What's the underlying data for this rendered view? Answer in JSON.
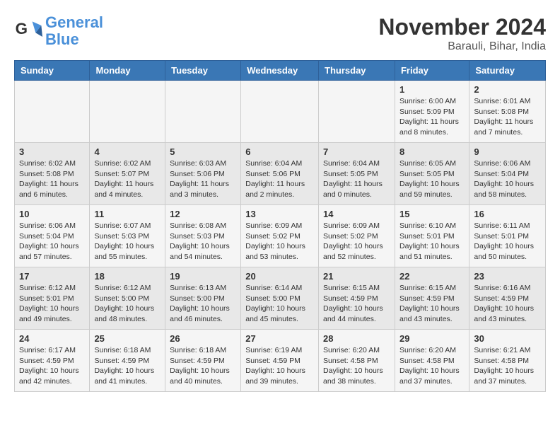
{
  "header": {
    "logo_line1": "General",
    "logo_line2": "Blue",
    "month_title": "November 2024",
    "location": "Barauli, Bihar, India"
  },
  "weekdays": [
    "Sunday",
    "Monday",
    "Tuesday",
    "Wednesday",
    "Thursday",
    "Friday",
    "Saturday"
  ],
  "weeks": [
    [
      {
        "num": "",
        "info": ""
      },
      {
        "num": "",
        "info": ""
      },
      {
        "num": "",
        "info": ""
      },
      {
        "num": "",
        "info": ""
      },
      {
        "num": "",
        "info": ""
      },
      {
        "num": "1",
        "info": "Sunrise: 6:00 AM\nSunset: 5:09 PM\nDaylight: 11 hours\nand 8 minutes."
      },
      {
        "num": "2",
        "info": "Sunrise: 6:01 AM\nSunset: 5:08 PM\nDaylight: 11 hours\nand 7 minutes."
      }
    ],
    [
      {
        "num": "3",
        "info": "Sunrise: 6:02 AM\nSunset: 5:08 PM\nDaylight: 11 hours\nand 6 minutes."
      },
      {
        "num": "4",
        "info": "Sunrise: 6:02 AM\nSunset: 5:07 PM\nDaylight: 11 hours\nand 4 minutes."
      },
      {
        "num": "5",
        "info": "Sunrise: 6:03 AM\nSunset: 5:06 PM\nDaylight: 11 hours\nand 3 minutes."
      },
      {
        "num": "6",
        "info": "Sunrise: 6:04 AM\nSunset: 5:06 PM\nDaylight: 11 hours\nand 2 minutes."
      },
      {
        "num": "7",
        "info": "Sunrise: 6:04 AM\nSunset: 5:05 PM\nDaylight: 11 hours\nand 0 minutes."
      },
      {
        "num": "8",
        "info": "Sunrise: 6:05 AM\nSunset: 5:05 PM\nDaylight: 10 hours\nand 59 minutes."
      },
      {
        "num": "9",
        "info": "Sunrise: 6:06 AM\nSunset: 5:04 PM\nDaylight: 10 hours\nand 58 minutes."
      }
    ],
    [
      {
        "num": "10",
        "info": "Sunrise: 6:06 AM\nSunset: 5:04 PM\nDaylight: 10 hours\nand 57 minutes."
      },
      {
        "num": "11",
        "info": "Sunrise: 6:07 AM\nSunset: 5:03 PM\nDaylight: 10 hours\nand 55 minutes."
      },
      {
        "num": "12",
        "info": "Sunrise: 6:08 AM\nSunset: 5:03 PM\nDaylight: 10 hours\nand 54 minutes."
      },
      {
        "num": "13",
        "info": "Sunrise: 6:09 AM\nSunset: 5:02 PM\nDaylight: 10 hours\nand 53 minutes."
      },
      {
        "num": "14",
        "info": "Sunrise: 6:09 AM\nSunset: 5:02 PM\nDaylight: 10 hours\nand 52 minutes."
      },
      {
        "num": "15",
        "info": "Sunrise: 6:10 AM\nSunset: 5:01 PM\nDaylight: 10 hours\nand 51 minutes."
      },
      {
        "num": "16",
        "info": "Sunrise: 6:11 AM\nSunset: 5:01 PM\nDaylight: 10 hours\nand 50 minutes."
      }
    ],
    [
      {
        "num": "17",
        "info": "Sunrise: 6:12 AM\nSunset: 5:01 PM\nDaylight: 10 hours\nand 49 minutes."
      },
      {
        "num": "18",
        "info": "Sunrise: 6:12 AM\nSunset: 5:00 PM\nDaylight: 10 hours\nand 48 minutes."
      },
      {
        "num": "19",
        "info": "Sunrise: 6:13 AM\nSunset: 5:00 PM\nDaylight: 10 hours\nand 46 minutes."
      },
      {
        "num": "20",
        "info": "Sunrise: 6:14 AM\nSunset: 5:00 PM\nDaylight: 10 hours\nand 45 minutes."
      },
      {
        "num": "21",
        "info": "Sunrise: 6:15 AM\nSunset: 4:59 PM\nDaylight: 10 hours\nand 44 minutes."
      },
      {
        "num": "22",
        "info": "Sunrise: 6:15 AM\nSunset: 4:59 PM\nDaylight: 10 hours\nand 43 minutes."
      },
      {
        "num": "23",
        "info": "Sunrise: 6:16 AM\nSunset: 4:59 PM\nDaylight: 10 hours\nand 43 minutes."
      }
    ],
    [
      {
        "num": "24",
        "info": "Sunrise: 6:17 AM\nSunset: 4:59 PM\nDaylight: 10 hours\nand 42 minutes."
      },
      {
        "num": "25",
        "info": "Sunrise: 6:18 AM\nSunset: 4:59 PM\nDaylight: 10 hours\nand 41 minutes."
      },
      {
        "num": "26",
        "info": "Sunrise: 6:18 AM\nSunset: 4:59 PM\nDaylight: 10 hours\nand 40 minutes."
      },
      {
        "num": "27",
        "info": "Sunrise: 6:19 AM\nSunset: 4:59 PM\nDaylight: 10 hours\nand 39 minutes."
      },
      {
        "num": "28",
        "info": "Sunrise: 6:20 AM\nSunset: 4:58 PM\nDaylight: 10 hours\nand 38 minutes."
      },
      {
        "num": "29",
        "info": "Sunrise: 6:20 AM\nSunset: 4:58 PM\nDaylight: 10 hours\nand 37 minutes."
      },
      {
        "num": "30",
        "info": "Sunrise: 6:21 AM\nSunset: 4:58 PM\nDaylight: 10 hours\nand 37 minutes."
      }
    ]
  ]
}
